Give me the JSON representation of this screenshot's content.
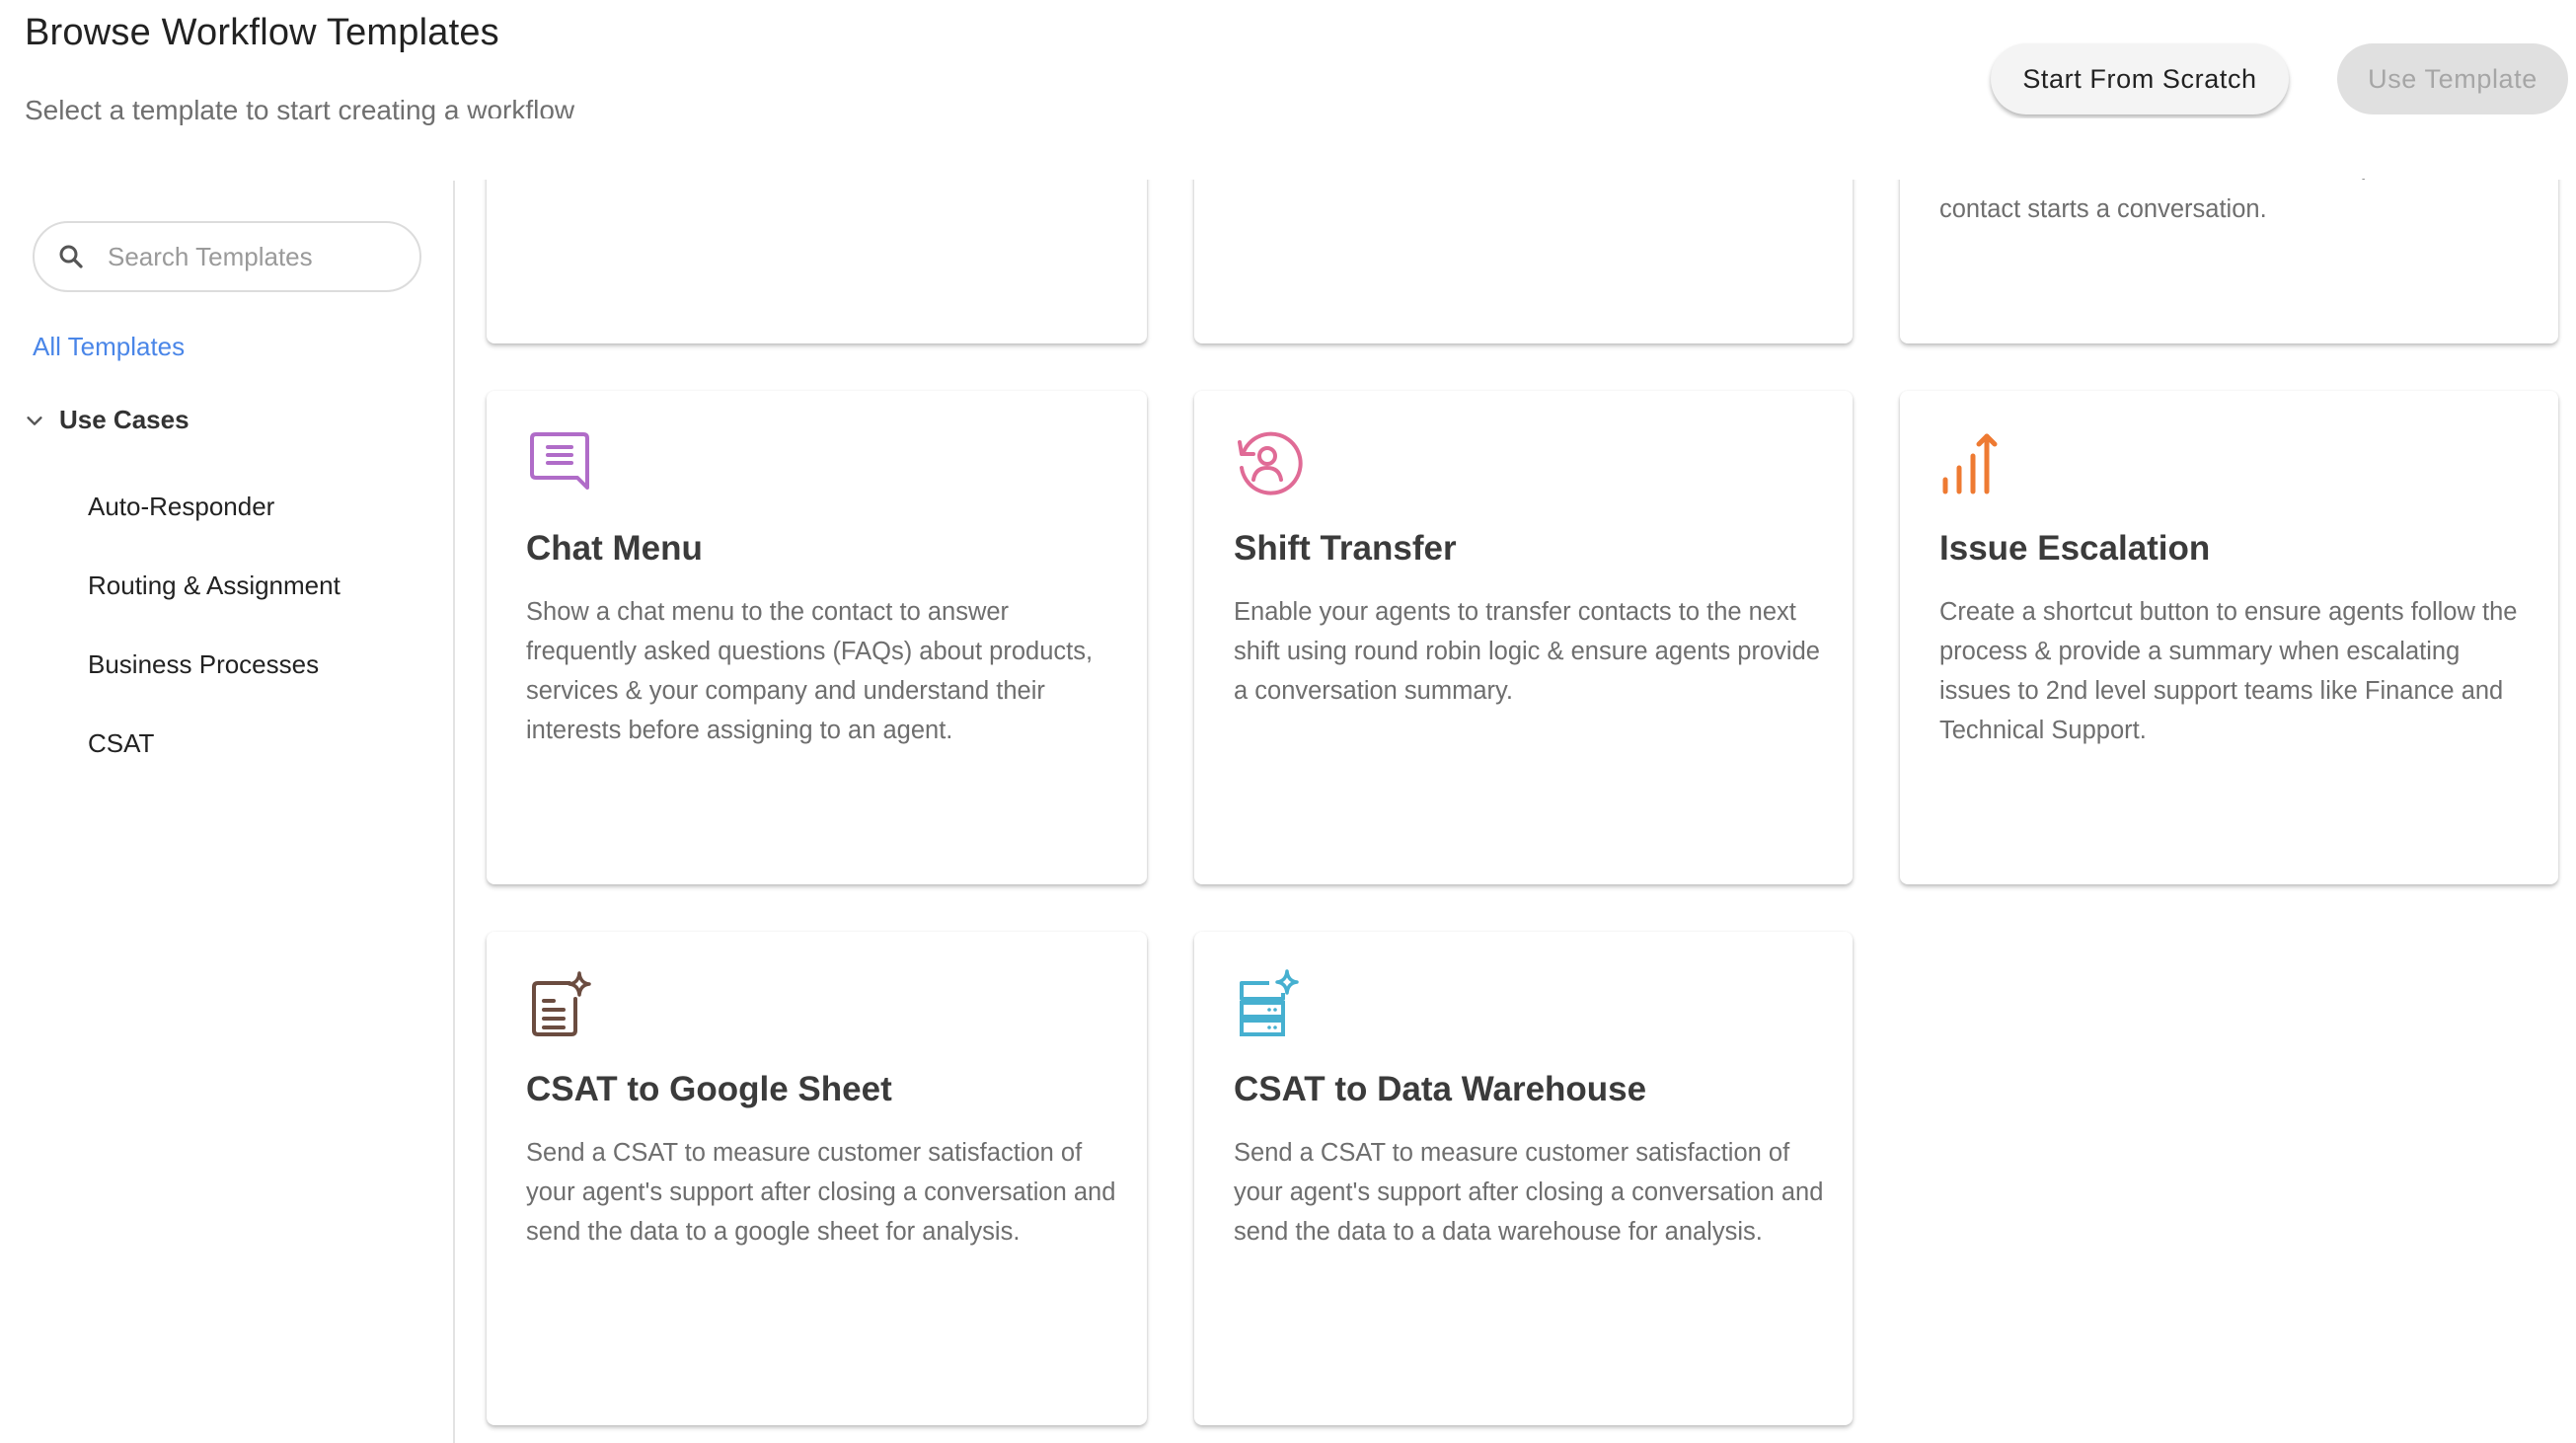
{
  "header": {
    "title": "Browse Workflow Templates",
    "subtitle": "Select a template to start creating a workflow",
    "start_from_scratch_label": "Start From Scratch",
    "use_template_label": "Use Template"
  },
  "sidebar": {
    "search_placeholder": "Search Templates",
    "search_value": "",
    "all_templates_label": "All Templates",
    "group_label": "Use Cases",
    "group_expanded": true,
    "items": [
      {
        "label": "Auto-Responder"
      },
      {
        "label": "Routing & Assignment"
      },
      {
        "label": "Business Processes"
      },
      {
        "label": "CSAT"
      }
    ]
  },
  "colors": {
    "accent_link": "#4a86e8",
    "chat_menu_icon": "#b06cc8",
    "shift_transfer_icon": "#e06b96",
    "issue_escalation_icon": "#ee7a32",
    "csat_sheet_icon": "#6b4c40",
    "csat_warehouse_icon": "#46b0d0"
  },
  "templates": {
    "partial_top_row": [
      {
        "visible_text": ""
      },
      {
        "visible_text": ""
      },
      {
        "visible_text": "contact starts a conversation."
      }
    ],
    "cards": [
      {
        "icon": "chat-menu-icon",
        "title": "Chat Menu",
        "description": "Show a chat menu to the contact to answer frequently asked questions (FAQs) about products, services & your company and understand their interests before assigning to an agent."
      },
      {
        "icon": "shift-transfer-icon",
        "title": "Shift Transfer",
        "description": "Enable your agents to transfer contacts to the next shift using round robin logic & ensure agents provide a conversation summary."
      },
      {
        "icon": "escalation-chart-icon",
        "title": "Issue Escalation",
        "description": "Create a shortcut button to ensure agents follow the process & provide a summary when escalating issues to 2nd level support teams like Finance and Technical Support."
      },
      {
        "icon": "document-sparkle-icon",
        "title": "CSAT to Google Sheet",
        "description": "Send a CSAT to measure customer satisfaction of your agent's support after closing a conversation and send the data to a google sheet for analysis."
      },
      {
        "icon": "database-sparkle-icon",
        "title": "CSAT to Data Warehouse",
        "description": "Send a CSAT to measure customer satisfaction of your agent's support after closing a conversation and send the data to a data warehouse for analysis."
      }
    ]
  }
}
